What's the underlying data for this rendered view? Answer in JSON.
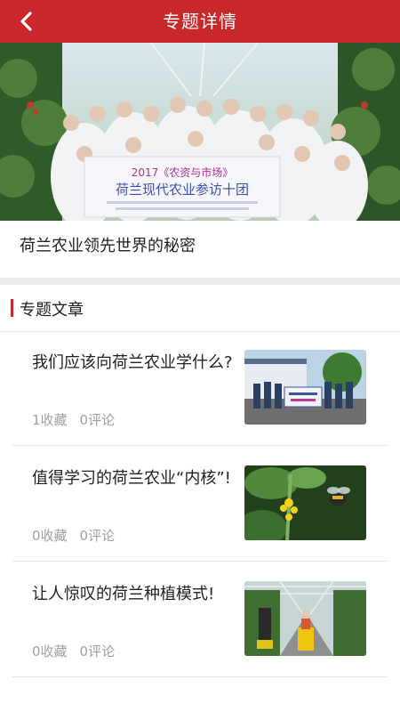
{
  "header": {
    "title": "专题详情",
    "back_icon": "chevron-left-icon"
  },
  "hero": {
    "banner_line1": "2017《农资与市场》",
    "banner_line2": "荷兰现代农业参访十团"
  },
  "topic": {
    "title": "荷兰农业领先世界的秘密"
  },
  "section": {
    "label": "专题文章",
    "accent": "#c8282c"
  },
  "articles": [
    {
      "title": "我们应该向荷兰农业学什么?",
      "favorites": "1收藏",
      "comments": "0评论"
    },
    {
      "title": "值得学习的荷兰农业“内核”!",
      "favorites": "0收藏",
      "comments": "0评论"
    },
    {
      "title": "让人惊叹的荷兰种植模式!",
      "favorites": "0收藏",
      "comments": "0评论"
    }
  ],
  "colors": {
    "brand": "#c8282c",
    "meta_text": "#a0a0a0",
    "separator": "#ececec"
  }
}
